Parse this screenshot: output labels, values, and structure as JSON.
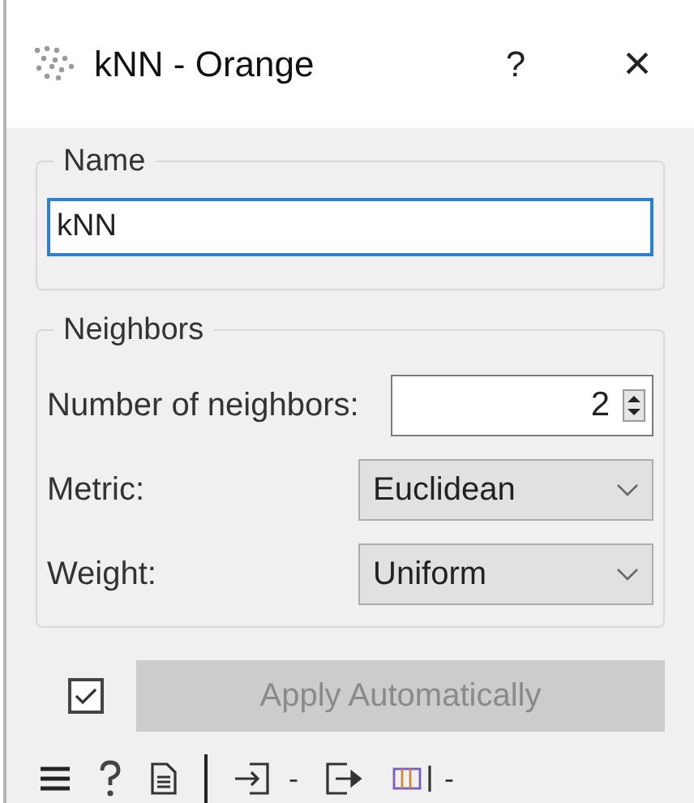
{
  "window": {
    "title": "kNN - Orange",
    "help": "?",
    "close": "×"
  },
  "name_group": {
    "title": "Name",
    "value": "kNN"
  },
  "neighbors_group": {
    "title": "Neighbors",
    "rows": [
      {
        "kind": "spin",
        "label": "Number of neighbors:",
        "value": "2"
      },
      {
        "kind": "combo",
        "label": "Metric:",
        "value": "Euclidean"
      },
      {
        "kind": "combo",
        "label": "Weight:",
        "value": "Uniform"
      }
    ]
  },
  "apply": {
    "checked": true,
    "label": "Apply Automatically",
    "disabled": true
  },
  "status_bar": {
    "input_count": "-",
    "output_count": "-"
  }
}
